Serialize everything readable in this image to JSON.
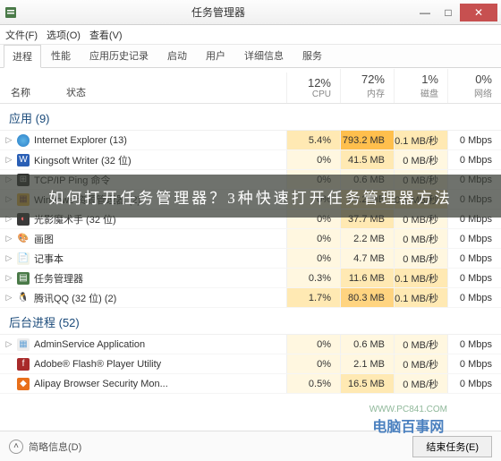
{
  "title": "任务管理器",
  "winbtns": {
    "min": "—",
    "max": "□",
    "close": "✕"
  },
  "menu": [
    "文件(F)",
    "选项(O)",
    "查看(V)"
  ],
  "tabs": [
    "进程",
    "性能",
    "应用历史记录",
    "启动",
    "用户",
    "详细信息",
    "服务"
  ],
  "header": {
    "name": "名称",
    "status": "状态",
    "cols": [
      {
        "pct": "12%",
        "lbl": "CPU"
      },
      {
        "pct": "72%",
        "lbl": "内存"
      },
      {
        "pct": "1%",
        "lbl": "磁盘"
      },
      {
        "pct": "0%",
        "lbl": "网络"
      }
    ]
  },
  "groups": [
    {
      "title": "应用 (9)",
      "rows": [
        {
          "icon": "ie",
          "name": "Internet Explorer (13)",
          "cpu": "5.4%",
          "mem": "793.2 MB",
          "disk": "0.1 MB/秒",
          "net": "0 Mbps",
          "h": [
            "h2",
            "h4",
            "h2",
            ""
          ]
        },
        {
          "icon": "kw",
          "name": "Kingsoft Writer (32 位)",
          "cpu": "0%",
          "mem": "41.5 MB",
          "disk": "0 MB/秒",
          "net": "0 Mbps",
          "h": [
            "h1",
            "h2",
            "h1",
            ""
          ]
        },
        {
          "icon": "tcp",
          "name": "TCP/IP Ping 命令",
          "cpu": "0%",
          "mem": "0.6 MB",
          "disk": "0 MB/秒",
          "net": "0 Mbps",
          "h": [
            "h1",
            "h1",
            "h1",
            ""
          ]
        },
        {
          "icon": "win",
          "name": "Windows 资源管理器 (2)",
          "cpu": "0%",
          "mem": "54.2 MB",
          "disk": "0.1 MB/秒",
          "net": "0 Mbps",
          "h": [
            "h1",
            "h2",
            "h2",
            ""
          ]
        },
        {
          "icon": "gy",
          "name": "光影魔术手 (32 位)",
          "cpu": "0%",
          "mem": "37.7 MB",
          "disk": "0 MB/秒",
          "net": "0 Mbps",
          "h": [
            "h1",
            "h2",
            "h1",
            ""
          ]
        },
        {
          "icon": "paint",
          "name": "画图",
          "cpu": "0%",
          "mem": "2.2 MB",
          "disk": "0 MB/秒",
          "net": "0 Mbps",
          "h": [
            "h1",
            "h1",
            "h1",
            ""
          ]
        },
        {
          "icon": "note",
          "name": "记事本",
          "cpu": "0%",
          "mem": "4.7 MB",
          "disk": "0 MB/秒",
          "net": "0 Mbps",
          "h": [
            "h1",
            "h1",
            "h1",
            ""
          ]
        },
        {
          "icon": "tm",
          "name": "任务管理器",
          "cpu": "0.3%",
          "mem": "11.6 MB",
          "disk": "0.1 MB/秒",
          "net": "0 Mbps",
          "h": [
            "h1",
            "h2",
            "h2",
            ""
          ]
        },
        {
          "icon": "qq",
          "name": "腾讯QQ (32 位) (2)",
          "cpu": "1.7%",
          "mem": "80.3 MB",
          "disk": "0.1 MB/秒",
          "net": "0 Mbps",
          "h": [
            "h2",
            "h3",
            "h2",
            ""
          ]
        }
      ]
    },
    {
      "title": "后台进程 (52)",
      "rows": [
        {
          "icon": "as",
          "name": "AdminService Application",
          "cpu": "0%",
          "mem": "0.6 MB",
          "disk": "0 MB/秒",
          "net": "0 Mbps",
          "h": [
            "h1",
            "h1",
            "h1",
            ""
          ]
        },
        {
          "icon": "flash",
          "name": "Adobe® Flash® Player Utility",
          "cpu": "0%",
          "mem": "2.1 MB",
          "disk": "0 MB/秒",
          "net": "0 Mbps",
          "h": [
            "h1",
            "h1",
            "h1",
            ""
          ]
        },
        {
          "icon": "ali",
          "name": "Alipay Browser Security Mon...",
          "cpu": "0.5%",
          "mem": "16.5 MB",
          "disk": "0 MB/秒",
          "net": "0 Mbps",
          "h": [
            "h1",
            "h2",
            "h1",
            ""
          ]
        }
      ]
    }
  ],
  "footer": {
    "less": "简略信息(D)",
    "end": "结束任务(E)"
  },
  "overlay": "如何打开任务管理器？3种快速打开任务管理器方法",
  "watermark": {
    "url": "WWW.PC841.COM",
    "cn": "电脑百事网"
  },
  "icons": {
    "kw": {
      "bg": "#2a5fb5",
      "txt": "W",
      "col": "#fff"
    },
    "tcp": {
      "bg": "#333",
      "txt": "⊞",
      "col": "#ddd"
    },
    "win": {
      "bg": "#f6c34a",
      "txt": "▦",
      "col": "#855"
    },
    "gy": {
      "bg": "#3a3a3a",
      "txt": "◐",
      "col": "#e66"
    },
    "paint": {
      "bg": "#fff",
      "txt": "🎨",
      "col": ""
    },
    "note": {
      "bg": "#f3f3e8",
      "txt": "📄",
      "col": ""
    },
    "tm": {
      "bg": "#4a7a48",
      "txt": "▤",
      "col": "#fff"
    },
    "qq": {
      "bg": "#fff",
      "txt": "🐧",
      "col": ""
    },
    "as": {
      "bg": "#eee",
      "txt": "▦",
      "col": "#66a3d6"
    },
    "flash": {
      "bg": "#a82a2a",
      "txt": "f",
      "col": "#fff"
    },
    "ali": {
      "bg": "#e86f1a",
      "txt": "◆",
      "col": "#fff"
    }
  }
}
